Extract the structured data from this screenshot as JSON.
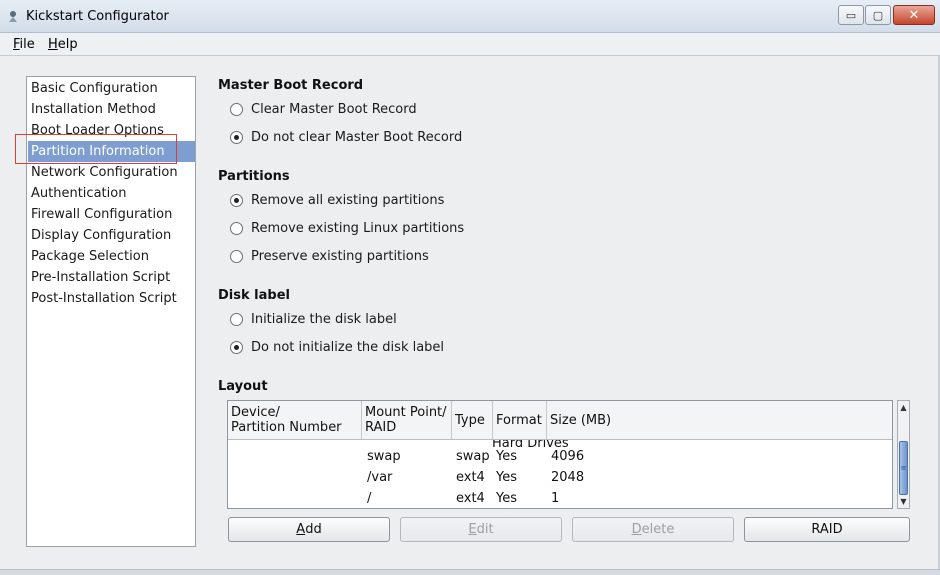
{
  "window": {
    "title": "Kickstart Configurator",
    "controls": {
      "minimize": "▭",
      "maximize": "▢",
      "close": "✕"
    }
  },
  "menu": [
    {
      "label": "File",
      "mnemonic": "F",
      "rest": "ile"
    },
    {
      "label": "Help",
      "mnemonic": "H",
      "rest": "elp"
    }
  ],
  "nav": {
    "selected_index": 3,
    "items": [
      "Basic Configuration",
      "Installation Method",
      "Boot Loader Options",
      "Partition Information",
      "Network Configuration",
      "Authentication",
      "Firewall Configuration",
      "Display Configuration",
      "Package Selection",
      "Pre-Installation Script",
      "Post-Installation Script"
    ]
  },
  "mbr": {
    "title": "Master Boot Record",
    "options": [
      {
        "label": "Clear Master Boot Record",
        "checked": false
      },
      {
        "label": "Do not clear Master Boot Record",
        "checked": true
      }
    ]
  },
  "partitions": {
    "title": "Partitions",
    "options": [
      {
        "label": "Remove all existing partitions",
        "checked": true
      },
      {
        "label": "Remove existing Linux partitions",
        "checked": false
      },
      {
        "label": "Preserve existing partitions",
        "checked": false
      }
    ]
  },
  "disklabel": {
    "title": "Disk label",
    "options": [
      {
        "label": "Initialize the disk label",
        "checked": false
      },
      {
        "label": "Do not initialize the disk label",
        "checked": true
      }
    ]
  },
  "layout": {
    "title": "Layout",
    "columns": {
      "device_line1": "Device/",
      "device_line2": "Partition Number",
      "mount_line1": "Mount Point/",
      "mount_line2": "RAID",
      "type": "Type",
      "format": "Format",
      "size": "Size (MB)"
    },
    "clipped_row_text": "Hard Drives",
    "rows": [
      {
        "mount": "swap",
        "type": "swap",
        "format": "Yes",
        "size": "4096"
      },
      {
        "mount": "/var",
        "type": "ext4",
        "format": "Yes",
        "size": "2048"
      },
      {
        "mount": "/",
        "type": "ext4",
        "format": "Yes",
        "size": "1"
      }
    ],
    "scroll": {
      "up": "▲",
      "down": "▼",
      "grip": "≡"
    }
  },
  "buttons": {
    "add": {
      "mnemonic": "A",
      "rest": "dd",
      "enabled": true
    },
    "edit": {
      "mnemonic": "E",
      "rest": "dit",
      "enabled": false
    },
    "delete": {
      "mnemonic": "D",
      "rest": "elete",
      "enabled": false
    },
    "raid": {
      "label": "RAID",
      "enabled": true
    }
  }
}
